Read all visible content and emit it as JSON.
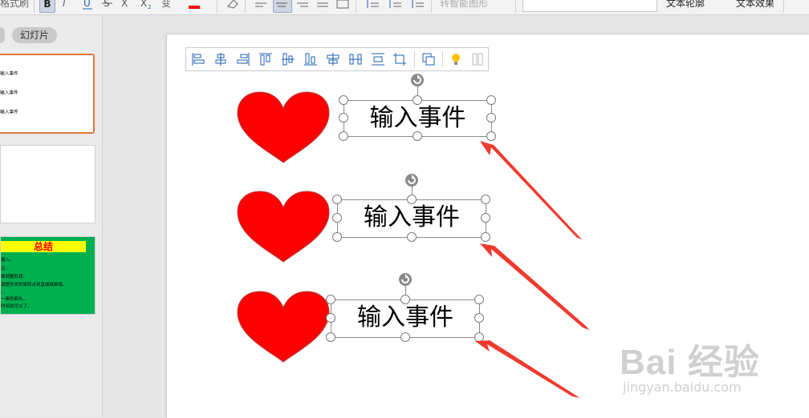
{
  "ribbon": {
    "format_painter_label": "格式刷",
    "bold_label": "B",
    "italic_label": "I",
    "change_case_label": "变",
    "smart_shape_label": "转智能图形",
    "text_outline_label": "文本轮廓",
    "text_effect_label": "文本效果",
    "font_name_value": ""
  },
  "left_pane": {
    "tab_label": "幻灯片",
    "slides": [
      {
        "lines": [
          "输入事件",
          "输入事件",
          "输入事件"
        ]
      },
      {
        "lines": []
      },
      {
        "title": "总结",
        "lines": [
          "插入。",
          "泛。",
          "择调整形状。",
          "调整形状的旋转点到直接成新版。",
          "。",
          "一画色箭头。",
          "时间就可以了。"
        ]
      }
    ]
  },
  "slide": {
    "text_boxes": [
      {
        "text": "输入事件"
      },
      {
        "text": "输入事件"
      },
      {
        "text": "输入事件"
      }
    ]
  },
  "colors": {
    "heart_fill": "#ff0000",
    "arrow": "#f03a2e",
    "thumb3_bg": "#00b050",
    "thumb3_title_bg": "#ffff00",
    "selected_thumb_border": "#e0763b"
  },
  "watermark": {
    "brand": "Bai 经验",
    "url": "jingyan.baidu.com"
  },
  "icons": {
    "align_toolbar": [
      "align-left-icon",
      "align-center-icon",
      "align-right-icon",
      "align-top-icon",
      "align-middle-icon",
      "align-bottom-icon",
      "distribute-horizontal-icon",
      "distribute-horizontal-spacing-icon",
      "distribute-vertical-icon",
      "crop-icon",
      "group-icon",
      "lightbulb-icon",
      "more-icon"
    ]
  }
}
